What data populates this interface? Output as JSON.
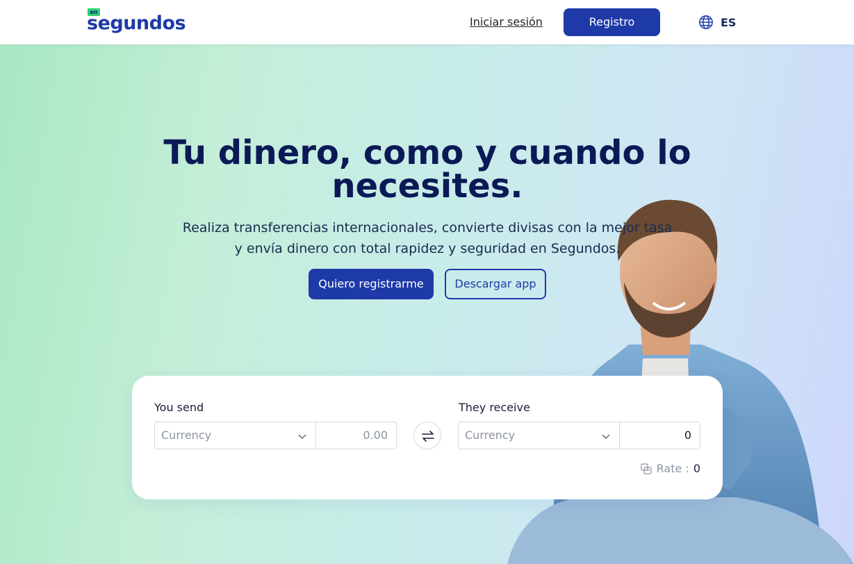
{
  "header": {
    "logo_badge": "en",
    "logo_text": "segundos",
    "login_label": "Iniciar sesión",
    "register_label": "Registro",
    "language": "ES"
  },
  "hero": {
    "title": "Tu dinero, como y cuando lo necesites.",
    "subtitle": "Realiza transferencias internacionales, convierte divisas con la mejor tasa y envía dinero con total rapidez y seguridad en Segundos.",
    "primary_cta": "Quiero registrarme",
    "secondary_cta": "Descargar app"
  },
  "converter": {
    "send_label": "You send",
    "send_currency_placeholder": "Currency",
    "send_amount": "0.00",
    "receive_label": "They receive",
    "receive_currency_placeholder": "Currency",
    "receive_amount": "0",
    "rate_label": "Rate :",
    "rate_value": "0"
  },
  "colors": {
    "brand_primary": "#1e3aa8",
    "brand_green": "#2ecf6f",
    "title_navy": "#0b1a56"
  },
  "icons": {
    "language": "globe-icon",
    "dropdown": "chevron-down-icon",
    "swap": "swap-arrows-icon",
    "rate": "coins-icon"
  }
}
